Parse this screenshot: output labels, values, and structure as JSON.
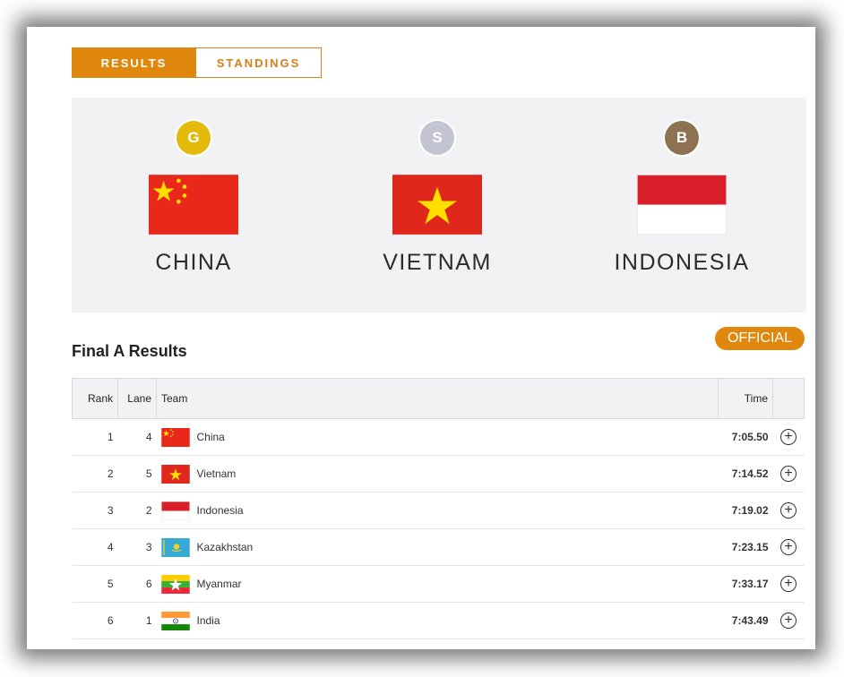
{
  "tabs": [
    {
      "label": "RESULTS",
      "active": true
    },
    {
      "label": "STANDINGS",
      "active": false
    }
  ],
  "medalists": [
    {
      "medal": "G",
      "medal_color": "#e3b90a",
      "country": "CHINA",
      "flag": "china-flag"
    },
    {
      "medal": "S",
      "medal_color": "#c2c4d2",
      "country": "VIETNAM",
      "flag": "vietnam-flag"
    },
    {
      "medal": "B",
      "medal_color": "#8c7250",
      "country": "INDONESIA",
      "flag": "indonesia-flag"
    }
  ],
  "results": {
    "title": "Final A Results",
    "status": "OFFICIAL",
    "columns": {
      "rank": "Rank",
      "lane": "Lane",
      "team": "Team",
      "time": "Time"
    },
    "rows": [
      {
        "rank": "1",
        "lane": "4",
        "team": "China",
        "flag": "china-flag",
        "time": "7:05.50"
      },
      {
        "rank": "2",
        "lane": "5",
        "team": "Vietnam",
        "flag": "vietnam-flag",
        "time": "7:14.52"
      },
      {
        "rank": "3",
        "lane": "2",
        "team": "Indonesia",
        "flag": "indonesia-flag",
        "time": "7:19.02"
      },
      {
        "rank": "4",
        "lane": "3",
        "team": "Kazakhstan",
        "flag": "kazakhstan-flag",
        "time": "7:23.15"
      },
      {
        "rank": "5",
        "lane": "6",
        "team": "Myanmar",
        "flag": "myanmar-flag",
        "time": "7:33.17"
      },
      {
        "rank": "6",
        "lane": "1",
        "team": "India",
        "flag": "india-flag",
        "time": "7:43.49"
      }
    ],
    "expand_icon": "plus-circle-icon"
  },
  "colors": {
    "accent": "#e0870e",
    "panel_bg": "#f2f2f4"
  }
}
